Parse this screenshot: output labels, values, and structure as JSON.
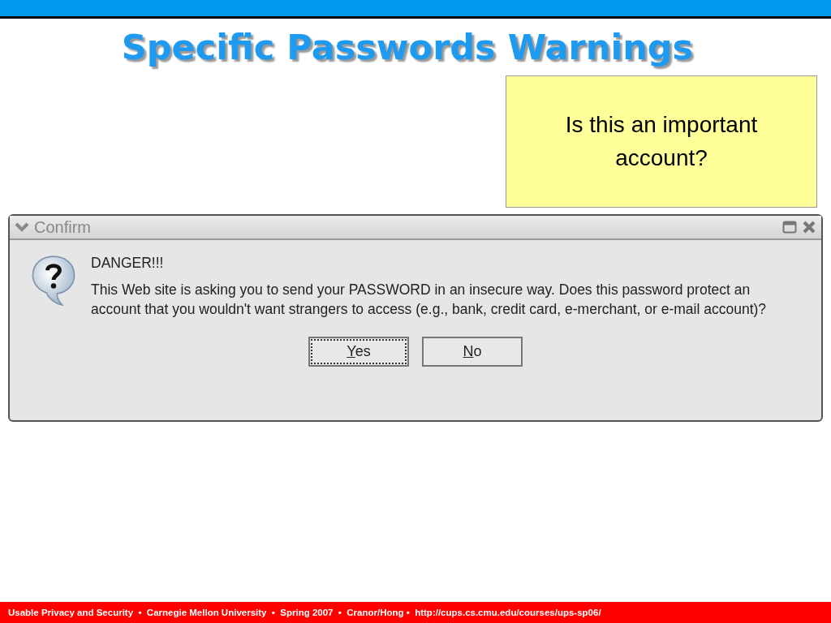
{
  "slide": {
    "title": "Specific Passwords Warnings",
    "callout": "Is this an important account?",
    "dialog": {
      "title": "Confirm",
      "heading": "DANGER!!!",
      "message": "This Web site is asking you to send your PASSWORD in an insecure way. Does this password protect an account that you wouldn't want strangers to access (e.g., bank, credit card, e-merchant, or e-mail account)?",
      "buttons": [
        {
          "mnemonic": "Y",
          "label_rest": "es",
          "focused": true
        },
        {
          "mnemonic": "N",
          "label_rest": "o",
          "focused": false
        }
      ]
    },
    "footer": "Usable Privacy and Security  •  Carnegie Mellon University  •  Spring 2007  •  Cranor/Hong •  http://cups.cs.cmu.edu/courses/ups-sp06/"
  }
}
